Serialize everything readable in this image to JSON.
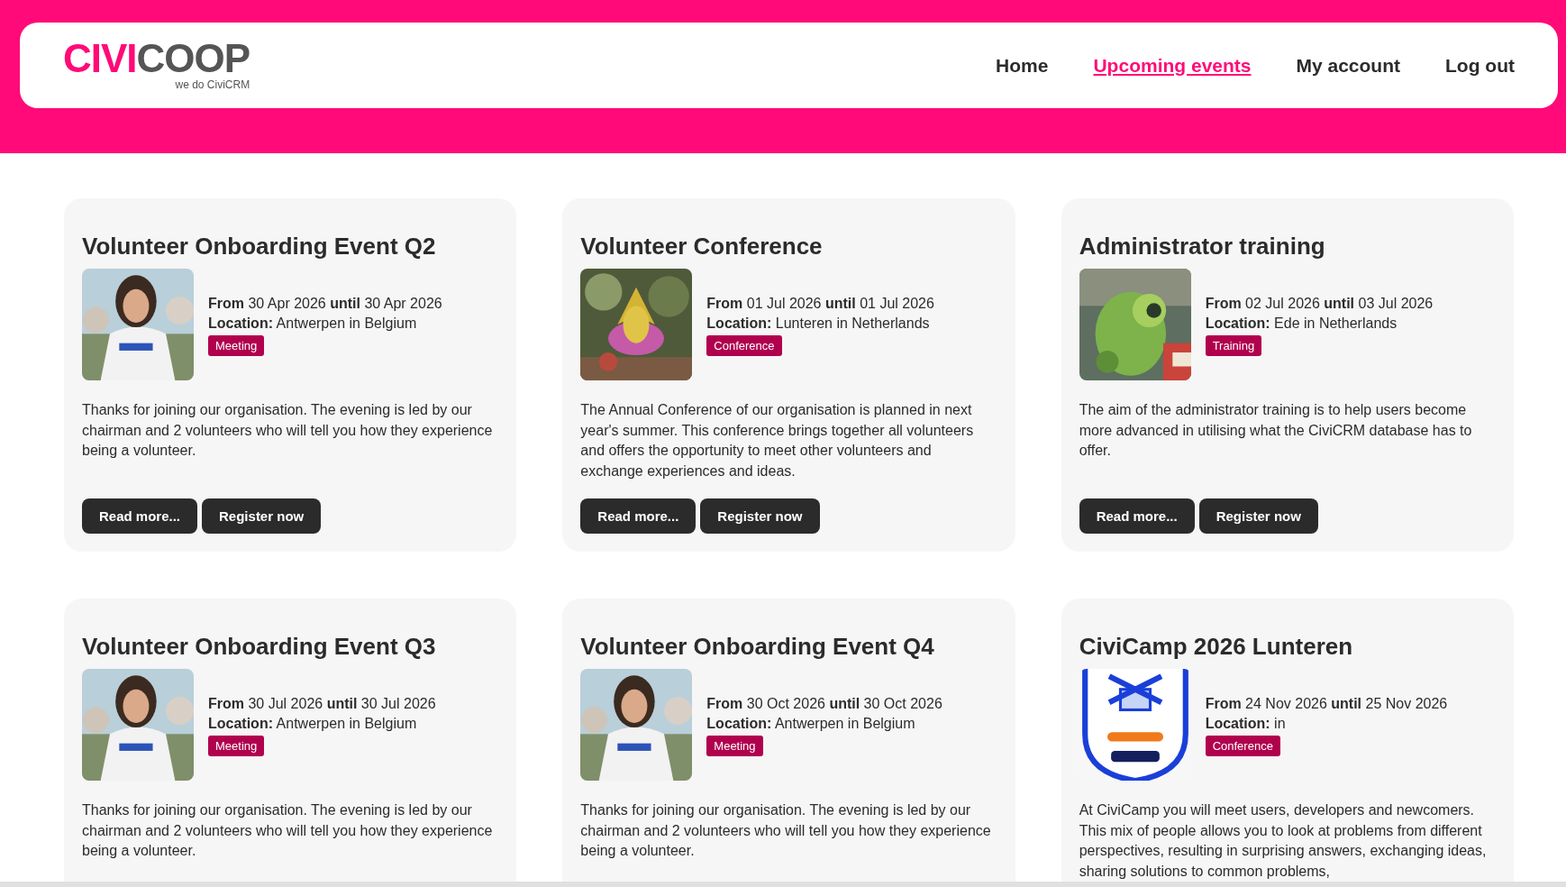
{
  "logo": {
    "brand_left": "CIVI",
    "brand_right": "COOP",
    "tagline": "we do CiviCRM"
  },
  "nav": [
    {
      "label": "Home",
      "selected": false
    },
    {
      "label": "Upcoming events",
      "selected": true
    },
    {
      "label": "My account",
      "selected": false
    },
    {
      "label": "Log out",
      "selected": false
    }
  ],
  "events": [
    {
      "title": "Volunteer Onboarding Event Q2",
      "dates": "**From** 30 Apr 2026 **until** 30 Apr 2026",
      "location": "**Location:** Antwerpen in Belgium",
      "tag": "Meeting",
      "description": "Thanks for joining our organisation. The evening is led by our chairman and 2 volunteers who will tell you how they experience being a volunteer.",
      "buttons": [
        "Read more...",
        "Register now"
      ]
    },
    {
      "title": "Volunteer Conference",
      "dates": "**From** 01 Jul 2026 **until** 01 Jul 2026",
      "location": "**Location:** Lunteren in Netherlands",
      "tag": "Conference",
      "description": "The Annual Conference of our organisation is planned in next year's summer. This conference brings together all volunteers and offers the opportunity to meet other volunteers and exchange experiences and ideas.",
      "buttons": [
        "Read more...",
        "Register now"
      ]
    },
    {
      "title": "Administrator training",
      "dates": "**From** 02 Jul 2026 **until** 03 Jul 2026",
      "location": "**Location:** Ede in Netherlands",
      "tag": "Training",
      "description": "The aim of the administrator training is to help users become more advanced in utilising what the CiviCRM database has to offer.",
      "buttons": [
        "Read more...",
        "Register now"
      ]
    },
    {
      "title": "Volunteer Onboarding Event Q3",
      "dates": "**From** 30 Jul 2026 **until** 30 Jul 2026",
      "location": "**Location:** Antwerpen in Belgium",
      "tag": "Meeting",
      "description": "Thanks for joining our organisation. The evening is led by our chairman and 2 volunteers who will tell you how they experience being a volunteer."
    },
    {
      "title": "Volunteer Onboarding Event Q4",
      "dates": "**From** 30 Oct 2026 **until** 30 Oct 2026",
      "location": "**Location:** Antwerpen in Belgium",
      "tag": "Meeting",
      "description": "Thanks for joining our organisation. The evening is led by our chairman and 2 volunteers who will tell you how they experience being a volunteer."
    },
    {
      "title": "CiviCamp 2026 Lunteren",
      "dates": "**From** 24 Nov 2026 **until** 25 Nov 2026",
      "location": "**Location:** in",
      "tag": "Conference",
      "description": "At CiviCamp you will meet users, developers and newcomers. This mix of people allows you to look at problems from different perspectives, resulting in surprising answers, exchanging ideas, sharing solutions to common problems,"
    }
  ]
}
